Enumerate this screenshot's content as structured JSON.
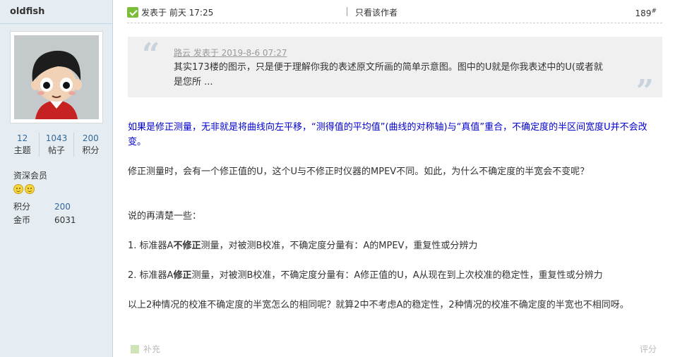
{
  "user": {
    "name": "oldfish",
    "stats": [
      {
        "value": "12",
        "label": "主题"
      },
      {
        "value": "1043",
        "label": "帖子"
      },
      {
        "value": "200",
        "label": "积分"
      }
    ],
    "group": "资深会员",
    "points_label": "积分",
    "points_value": "200",
    "coins_label": "金币",
    "coins_value": "6031"
  },
  "post": {
    "posted_text": "发表于 前天 17:25",
    "only_author": "只看该作者",
    "floor": "189",
    "floor_mark": "#",
    "quote": {
      "header": "路云 发表于 2019-8-6 07:27",
      "body": "其实173楼的图示，只是便于理解你我的表述原文所画的简单示意图。图中的U就是你我表述中的U(或者就是您所 ..."
    },
    "p1": "如果是修正测量，无非就是将曲线向左平移，“测得值的平均值”(曲线的对称轴)与“真值”重合，不确定度的半区间宽度U并不会改变。",
    "p2": "修正测量时，会有一个修正值的U，这个U与不修正时仪器的MPEV不同。如此，为什么不确定度的半宽会不变呢？",
    "p3": "说的再清楚一些：",
    "p4_a": "1. 标准器A",
    "p4_b": "不修正",
    "p4_c": "测量，对被测B校准，不确定度分量有：A的MPEV，重复性或分辨力",
    "p5_a": "2. 标准器A",
    "p5_b": "修正",
    "p5_c": "测量，对被测B校准，不确定度分量有：A修正值的U，A从现在到上次校准的稳定性，重复性或分辨力",
    "p6": "以上2种情况的校准不确定度的半宽怎么的相同呢？就算2中不考虑A的稳定性，2种情况的校准不确定度的半宽也不相同呀。",
    "add_label": "补充",
    "rate_label": "评分"
  }
}
